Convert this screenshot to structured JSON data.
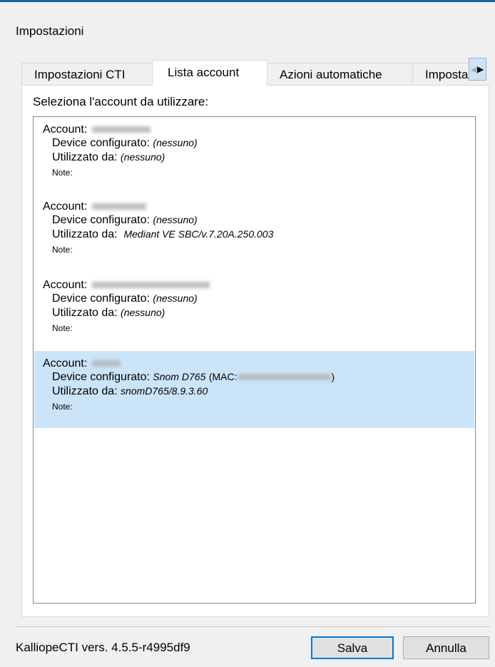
{
  "window": {
    "title": "Impostazioni"
  },
  "tabs": [
    {
      "label": "Impostazioni CTI",
      "active": false
    },
    {
      "label": "Lista account",
      "active": true
    },
    {
      "label": "Azioni automatiche",
      "active": false
    },
    {
      "label": "Impostazi",
      "active": false
    }
  ],
  "tab_scroll": {
    "left_icon": "triangle-left-icon",
    "right_icon": "triangle-right-icon"
  },
  "prompt": "Seleziona l'account da utilizzare:",
  "labels": {
    "account": "Account:",
    "device": "Device configurato:",
    "used_by": "Utilizzato da:",
    "note": "Note:",
    "mac_prefix": "(MAC:",
    "mac_suffix": ")"
  },
  "accounts": [
    {
      "device": "(nessuno)",
      "used_by": "(nessuno)",
      "selected": false
    },
    {
      "device": "(nessuno)",
      "used_by": "Mediant VE SBC/v.7.20A.250.003",
      "selected": false
    },
    {
      "device": "(nessuno)",
      "used_by": "(nessuno)",
      "selected": false
    },
    {
      "device": "Snom D765",
      "used_by": "snomD765/8.9.3.60",
      "selected": true
    }
  ],
  "footer": {
    "version": "KalliopeCTI vers. 4.5.5-r4995df9",
    "save_label": "Salva",
    "cancel_label": "Annulla"
  },
  "colors": {
    "accent": "#0078d7",
    "selection": "#cce4f7",
    "title_bar_line": "#1b63a6"
  }
}
